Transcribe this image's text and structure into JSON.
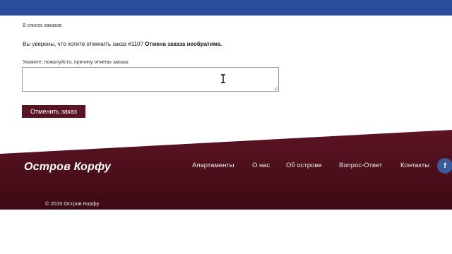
{
  "nav_back": "В список заказов",
  "confirm": {
    "question": "Вы уверены, что хотите отменить заказ #110?",
    "warning": "Отмена заказа необратима."
  },
  "reason": {
    "label": "Укажите, пожалуйста, причину отмены заказа:",
    "value": ""
  },
  "cancel_button": "Отменить заказ",
  "footer": {
    "brand": "Остров Корфу",
    "menu": [
      "Апартаменты",
      "О нас",
      "Об острове",
      "Вопрос-Ответ",
      "Контакты"
    ],
    "social_icon": "facebook-icon",
    "social_glyph": "f",
    "copyright": "© 2015 Остров Корфу"
  },
  "colors": {
    "header": "#2a4d9b",
    "footer": "#4e0f1c",
    "button": "#5a1322",
    "facebook": "#3b5a9a"
  }
}
